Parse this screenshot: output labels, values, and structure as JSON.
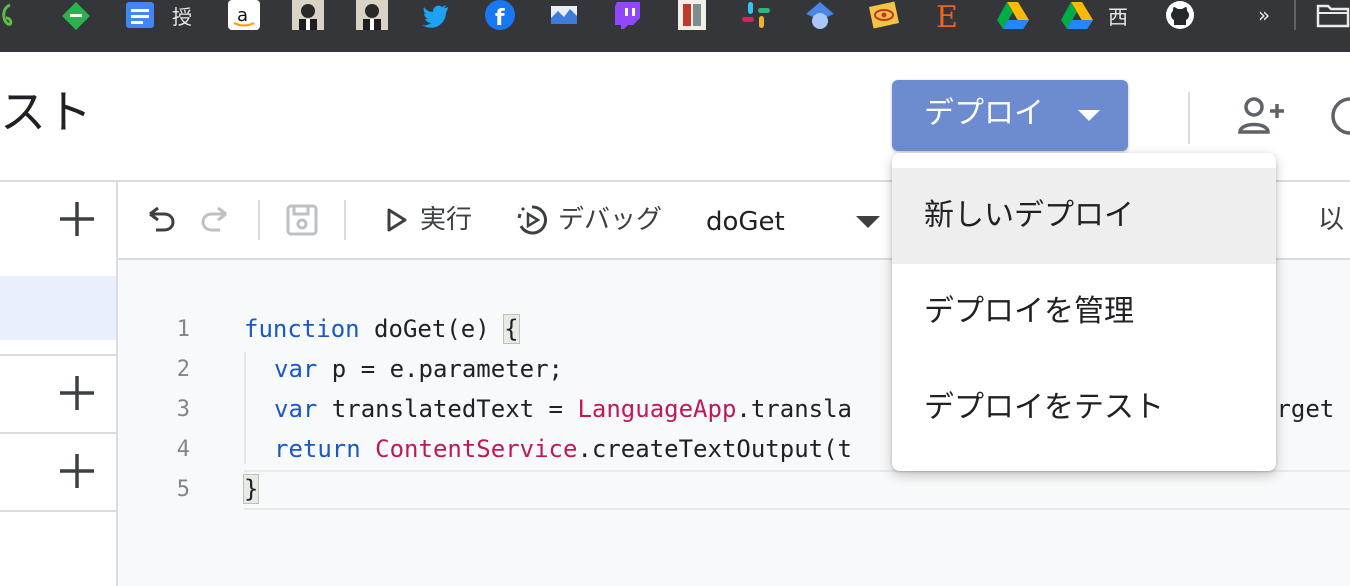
{
  "bookmarks": {
    "docs_label": "授",
    "nishi_label": "西",
    "more_label": "»"
  },
  "header": {
    "title": "スト",
    "deploy_label": "デプロイ"
  },
  "toolbar": {
    "run_label": "実行",
    "debug_label": "デバッグ",
    "function_name": "doGet",
    "right_partial": "以"
  },
  "editor": {
    "line_numbers": [
      "1",
      "2",
      "3",
      "4",
      "5"
    ],
    "line1": {
      "kw": "function",
      "rest": " doGet(e) ",
      "brace": "{"
    },
    "line2": {
      "kw": "var",
      "rest": " p = e.parameter;"
    },
    "line3": {
      "kw": "var",
      "mid": " translatedText = ",
      "cls": "LanguageApp",
      "rest": ".transla",
      "tail": "arget"
    },
    "line4": {
      "kw": "return",
      "sp": " ",
      "cls": "ContentService",
      "rest": ".createTextOutput(t"
    },
    "line5": {
      "brace": "}"
    }
  },
  "menu": {
    "items": [
      "新しいデプロイ",
      "デプロイを管理",
      "デプロイをテスト"
    ]
  },
  "colors": {
    "bookmark_bar": "#35363a",
    "deploy_button": "#6d8cd0",
    "keyword": "#1a57c9",
    "class_name": "#c2185b",
    "selected_file": "#e8f0fe"
  }
}
